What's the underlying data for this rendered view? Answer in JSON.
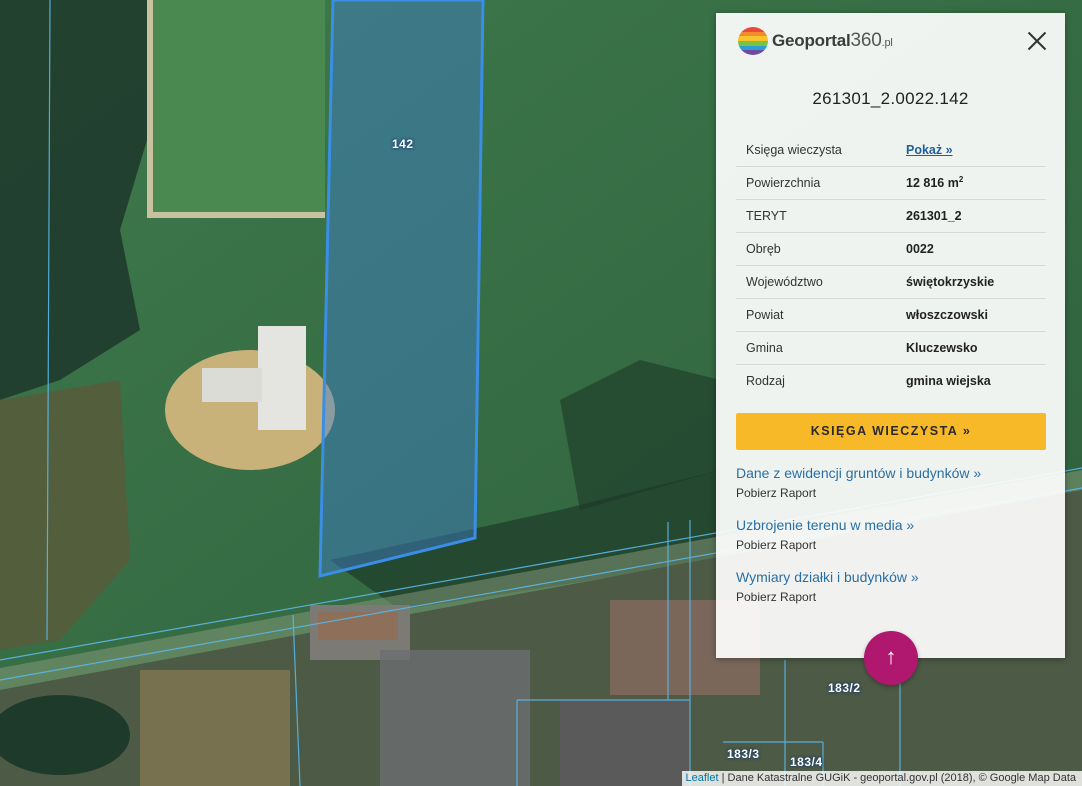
{
  "map": {
    "plot_labels": [
      "142",
      "183/2",
      "183/3",
      "183/4"
    ],
    "attribution": {
      "link": "Leaflet",
      "text": " | Dane Katastralne GUGiK - geoportal.gov.pl (2018), © Google Map Data"
    }
  },
  "panel": {
    "logo": {
      "brand": "Geoportal",
      "number": "360",
      "suffix": ".pl"
    },
    "title": "261301_2.0022.142",
    "rows": [
      {
        "label": "Księga wieczysta",
        "value": "Pokaż »",
        "link": true
      },
      {
        "label": "Powierzchnia",
        "value": "12 816 m",
        "sup": "2"
      },
      {
        "label": "TERYT",
        "value": "261301_2"
      },
      {
        "label": "Obręb",
        "value": "0022"
      },
      {
        "label": "Województwo",
        "value": "świętokrzyskie"
      },
      {
        "label": "Powiat",
        "value": "włoszczowski"
      },
      {
        "label": "Gmina",
        "value": "Kluczewsko"
      },
      {
        "label": "Rodzaj",
        "value": "gmina wiejska"
      }
    ],
    "kw_button": "KSIĘGA WIECZYSTA »",
    "links": [
      {
        "title": "Dane z ewidencji gruntów i budynków »",
        "sub": "Pobierz Raport"
      },
      {
        "title": "Uzbrojenie terenu w media »",
        "sub": "Pobierz Raport"
      },
      {
        "title": "Wymiary działki i budynków »",
        "sub": "Pobierz Raport"
      }
    ]
  },
  "scroll_top_icon": "↑",
  "colors": {
    "accent_yellow": "#f7b928",
    "fab_magenta": "#b0176e",
    "parcel_blue": "#3a8ee6"
  }
}
